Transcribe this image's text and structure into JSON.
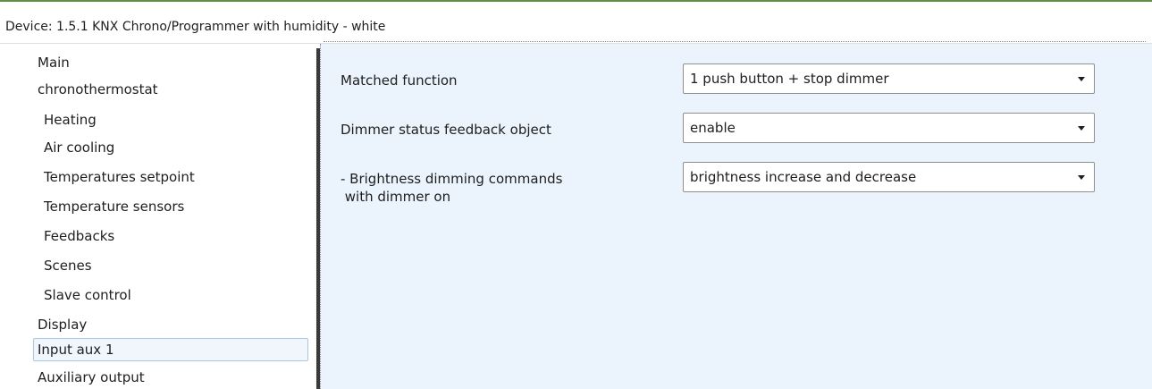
{
  "window": {
    "title": "Device: 1.5.1  KNX Chrono/Programmer with humidity - white"
  },
  "sidebar": {
    "items": [
      {
        "label": "Main"
      },
      {
        "label": "chronothermostat"
      },
      {
        "label": "Heating"
      },
      {
        "label": "Air cooling"
      },
      {
        "label": "Temperatures setpoint"
      },
      {
        "label": "Temperature sensors"
      },
      {
        "label": "Feedbacks"
      },
      {
        "label": "Scenes"
      },
      {
        "label": "Slave control"
      },
      {
        "label": "Display"
      },
      {
        "label": "Input aux 1"
      },
      {
        "label": "Auxiliary output"
      }
    ],
    "selected": "Input aux 1"
  },
  "params": [
    {
      "label": "Matched function",
      "value": "1 push button + stop dimmer"
    },
    {
      "label": "Dimmer status feedback object",
      "value": "enable"
    },
    {
      "label": "- Brightness dimming commands\n with dimmer on",
      "value": "brightness increase and decrease"
    }
  ],
  "colors": {
    "content_background": "#ebf4fc",
    "selected_item_border": "#a9c9e6",
    "accent_top_line": "#5d8f4a"
  }
}
